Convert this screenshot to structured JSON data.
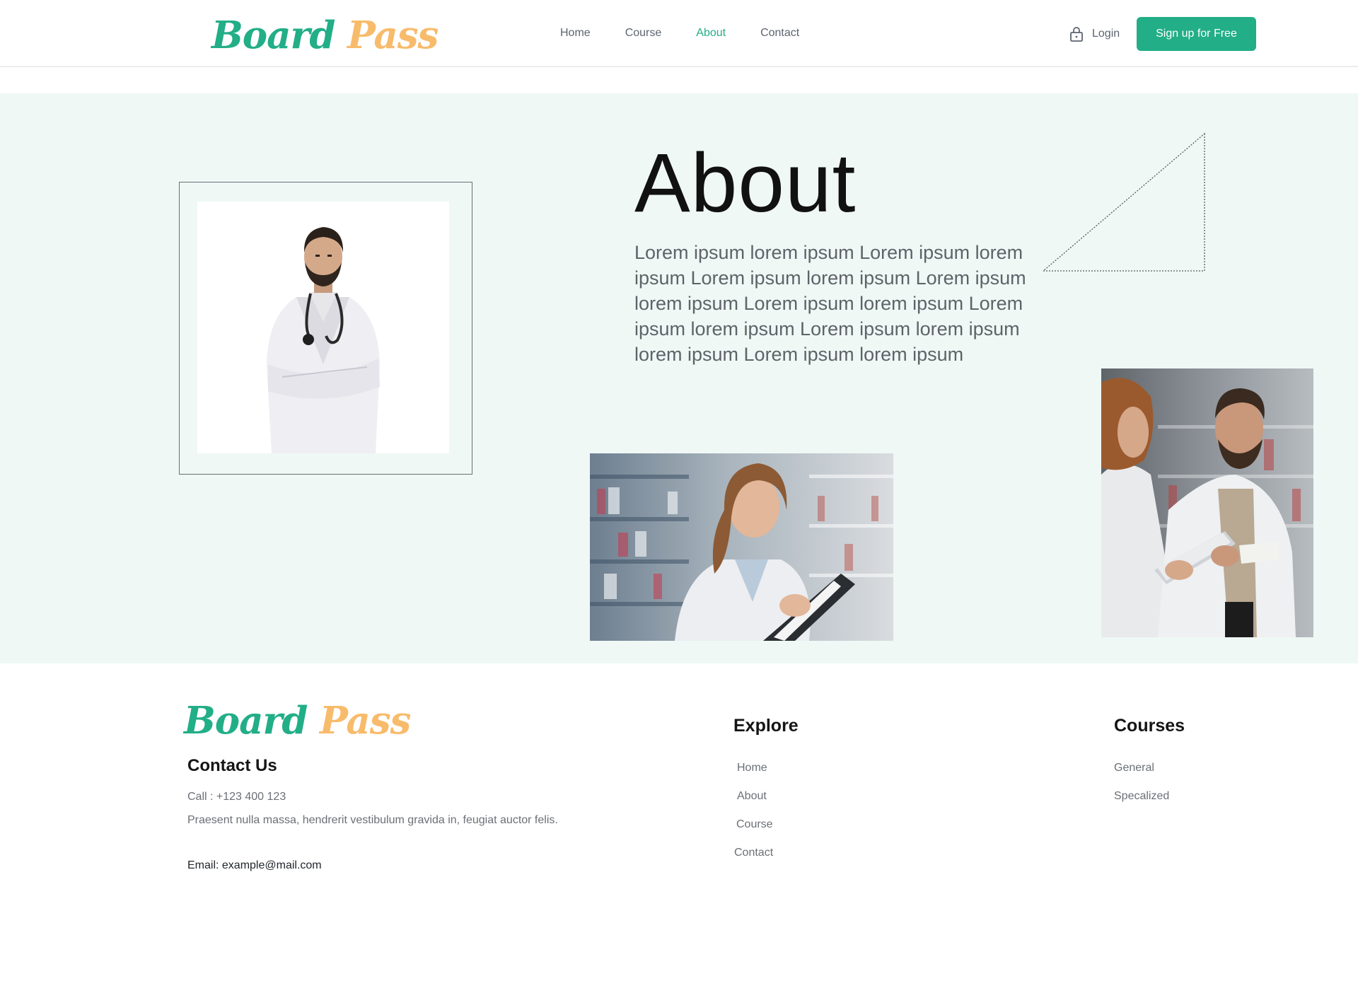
{
  "brand": {
    "word1": "Board",
    "word2": "Pass"
  },
  "nav": {
    "items": [
      {
        "label": "Home",
        "active": false
      },
      {
        "label": "Course",
        "active": false
      },
      {
        "label": "About",
        "active": true
      },
      {
        "label": "Contact",
        "active": false
      }
    ],
    "login_label": "Login",
    "signup_label": "Sign up for Free"
  },
  "about": {
    "title": "About",
    "text": "Lorem ipsum lorem ipsum Lorem ipsum lorem ipsum Lorem ipsum lorem ipsum Lorem ipsum lorem ipsum Lorem ipsum lorem ipsum Lorem ipsum lorem ipsum Lorem ipsum lorem ipsum lorem ipsum Lorem ipsum lorem ipsum"
  },
  "footer": {
    "contact_title": "Contact Us",
    "call": "Call : +123 400 123",
    "description": "Praesent nulla massa, hendrerit vestibulum gravida in, feugiat auctor felis.",
    "email": "Email: example@mail.com",
    "explore_title": "Explore",
    "explore_links": [
      "Home",
      "About",
      "Course",
      "Contact"
    ],
    "courses_title": "Courses",
    "course_links": [
      "General",
      "Specalized"
    ]
  },
  "colors": {
    "accent": "#22ae87",
    "logo_secondary": "#f8bb6b",
    "section_bg": "#eff8f5"
  },
  "icons": {
    "login": "lock-icon"
  }
}
